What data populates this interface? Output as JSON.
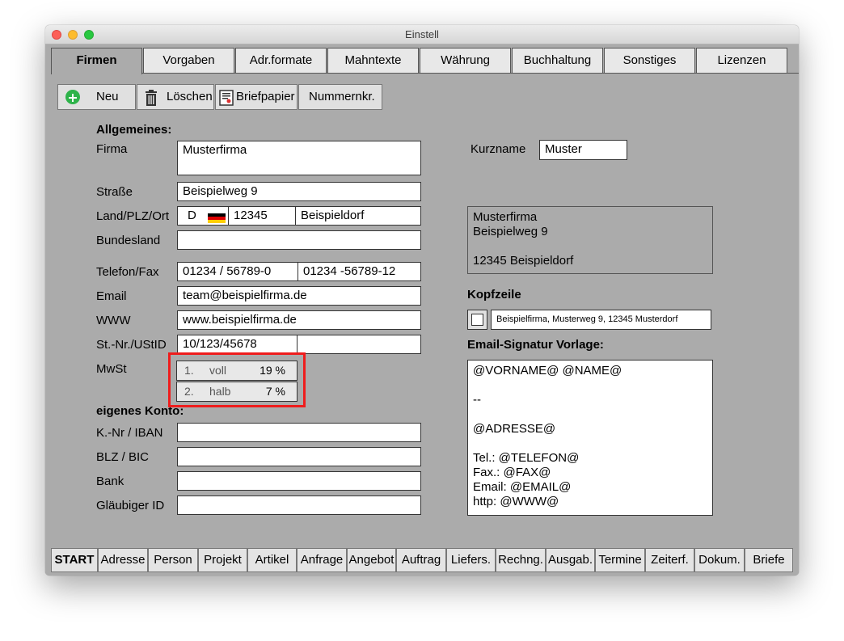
{
  "window": {
    "title": "Einstell"
  },
  "tabs": [
    {
      "label": "Firmen",
      "active": true
    },
    {
      "label": "Vorgaben"
    },
    {
      "label": "Adr.formate"
    },
    {
      "label": "Mahntexte"
    },
    {
      "label": "Währung"
    },
    {
      "label": "Buchhaltung"
    },
    {
      "label": "Sonstiges"
    },
    {
      "label": "Lizenzen"
    }
  ],
  "toolbar": {
    "neu": "Neu",
    "loeschen": "Löschen",
    "briefpapier": "Briefpapier",
    "nummernkr": "Nummernkr."
  },
  "labels": {
    "allgemeines": "Allgemeines:",
    "firma": "Firma",
    "strasse": "Straße",
    "land_plz_ort": "Land/PLZ/Ort",
    "bundesland": "Bundesland",
    "telefon_fax": "Telefon/Fax",
    "email": "Email",
    "www": "WWW",
    "st_nr": "St.-Nr./UStID",
    "mwst": "MwSt",
    "eigenes_konto": "eigenes Konto:",
    "iban": "K.-Nr / IBAN",
    "blz": "BLZ / BIC",
    "bank": "Bank",
    "glaeubiger": "Gläubiger ID",
    "kurzname": "Kurzname",
    "kopfzeile": "Kopfzeile",
    "signatur": "Email-Signatur Vorlage:"
  },
  "fields": {
    "firma": "Musterfirma",
    "kurzname": "Muster",
    "strasse": "Beispielweg 9",
    "land": "D",
    "plz": "12345",
    "ort": "Beispieldorf",
    "bundesland": "",
    "telefon": "01234 / 56789-0",
    "fax": "01234 -56789-12",
    "email": "team@beispielfirma.de",
    "www": "www.beispielfirma.de",
    "steuernr": "10/123/45678",
    "ustid": "",
    "iban": "",
    "blz": "",
    "bank": "",
    "glaeubiger": "",
    "kopfzeile": "Beispielfirma, Musterweg 9, 12345 Musterdorf"
  },
  "address_preview": {
    "line1": "Musterfirma",
    "line2": "Beispielweg 9",
    "line3": "",
    "line4": "12345 Beispieldorf"
  },
  "mwst": [
    {
      "nr": "1.",
      "name": "voll",
      "rate": "19 %"
    },
    {
      "nr": "2.",
      "name": "halb",
      "rate": "7 %"
    }
  ],
  "signature": [
    "@VORNAME@ @NAME@",
    "",
    "--",
    "",
    "@ADRESSE@",
    "",
    "Tel.: @TELEFON@",
    "Fax.: @FAX@",
    "Email: @EMAIL@",
    "http: @WWW@"
  ],
  "bottom_nav": [
    "START",
    "Adresse",
    "Person",
    "Projekt",
    "Artikel",
    "Anfrage",
    "Angebot",
    "Auftrag",
    "Liefers.",
    "Rechng.",
    "Ausgab.",
    "Termine",
    "Zeiterf.",
    "Dokum.",
    "Briefe"
  ],
  "colors": {
    "highlight": "#ef1c1c",
    "window_bg": "#ababab"
  }
}
